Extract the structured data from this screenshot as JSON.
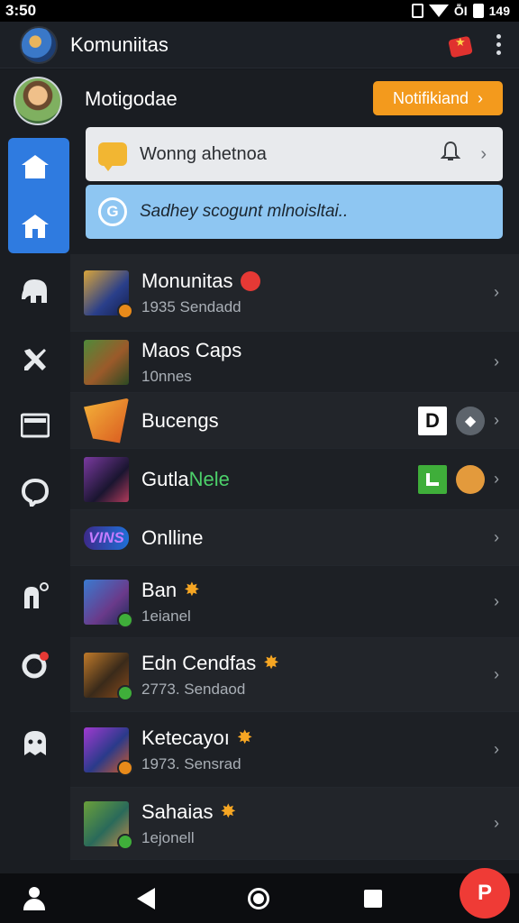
{
  "status_bar": {
    "time": "3:50",
    "signal_text": "ȬI",
    "battery_text": "149"
  },
  "top_bar": {
    "title": "Komuniitas"
  },
  "section": {
    "title": "Motigodae",
    "action_label": "Notifikiand",
    "action_chevron": "›"
  },
  "cards": {
    "light": {
      "text": "Wonng ahetnoa",
      "chevron": "›"
    },
    "blue": {
      "text": "Sadhey scogunt mlnoisltai..",
      "icon_text": "G"
    }
  },
  "rows": [
    {
      "title": "Monunitas",
      "subtitle": "1935 Sendadd",
      "trail_text": "›",
      "dot_color": "#e88a1a"
    },
    {
      "title": "Maos Caps",
      "subtitle": "10nnes",
      "trail_text": "›"
    },
    {
      "title": "Bucengs",
      "subtitle": "",
      "badge_text": "D",
      "trail_text": "›"
    },
    {
      "title": "Gutla",
      "title_accent": "Nele",
      "subtitle": "",
      "trail_text": "›"
    },
    {
      "title": "Onlline",
      "subtitle": "",
      "logo_text": "VINS",
      "trail_text": "›"
    },
    {
      "title": "Ban",
      "subtitle": "1eianel",
      "trail_text": "›",
      "dot_color": "#3fae3a"
    },
    {
      "title": "Edn Cendfas",
      "subtitle": "2773. Sendaod",
      "trail_text": "›",
      "dot_color": "#3fae3a"
    },
    {
      "title": "Ketecayoı",
      "subtitle": "1973. Sensrad",
      "trail_text": "›",
      "dot_color": "#e88a1a"
    },
    {
      "title": "Sahaias",
      "subtitle": "1ejonell",
      "trail_text": "›",
      "dot_color": "#3fae3a"
    }
  ],
  "rail": {
    "icons": [
      "home-icon",
      "home-alt-icon",
      "elephant-icon",
      "tools-icon",
      "card-icon",
      "chat-bubble-icon",
      "pin-icon",
      "refresh-icon",
      "ghost-icon"
    ]
  },
  "fab": {
    "label": "P"
  },
  "colors": {
    "accent": "#2f7be0",
    "orange": "#f39a1d",
    "fab": "#ef3b36",
    "card_blue": "#8ec6f2"
  }
}
